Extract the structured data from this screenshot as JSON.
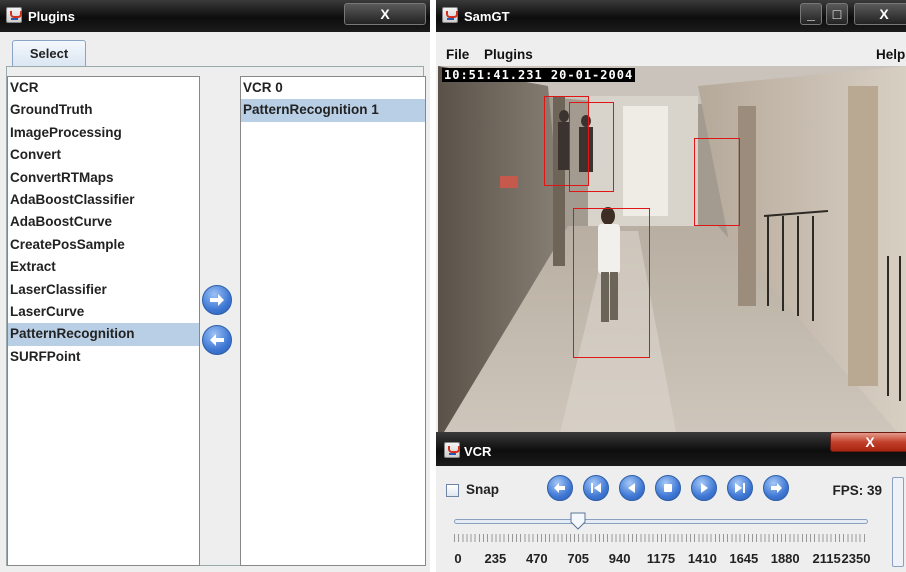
{
  "plugins_window": {
    "title": "Plugins",
    "close_label": "X",
    "tab_label": "Select",
    "available_plugins": [
      "VCR",
      "GroundTruth",
      "ImageProcessing",
      "Convert",
      "ConvertRTMaps",
      "AdaBoostClassifier",
      "AdaBoostCurve",
      "CreatePosSample",
      "Extract",
      "LaserClassifier",
      "LaserCurve",
      "PatternRecognition",
      "SURFPoint"
    ],
    "selected_available": "PatternRecognition",
    "active_plugins": [
      "VCR 0",
      "PatternRecognition 1"
    ],
    "selected_active": "PatternRecognition 1",
    "add_icon": "arrow-right-icon",
    "remove_icon": "arrow-left-icon"
  },
  "samgt_window": {
    "title": "SamGT",
    "minimize_label": "_",
    "maximize_label": "□",
    "close_label": "X",
    "menu": {
      "file": "File",
      "plugins": "Plugins",
      "help": "Help"
    },
    "timestamp": "10:51:41.231   20-01-2004",
    "detections": 4
  },
  "vcr_window": {
    "title": "VCR",
    "close_label": "X",
    "snap_label": "Snap",
    "snap_checked": false,
    "controls": [
      "back-icon",
      "rewind-icon",
      "step-back-icon",
      "stop-icon",
      "play-icon",
      "fast-forward-icon",
      "forward-icon"
    ],
    "fps_label": "FPS: 39",
    "slider_value": 705,
    "slider_min": 0,
    "slider_max": 2350,
    "tick_labels": [
      "0",
      "235",
      "470",
      "705",
      "940",
      "1175",
      "1410",
      "1645",
      "1880",
      "2115",
      "2350"
    ]
  },
  "colors": {
    "selection": "#b9cfe6",
    "button_blue": "#3f78d4",
    "detection_box": "#e01515",
    "titlebar": "#111111"
  }
}
